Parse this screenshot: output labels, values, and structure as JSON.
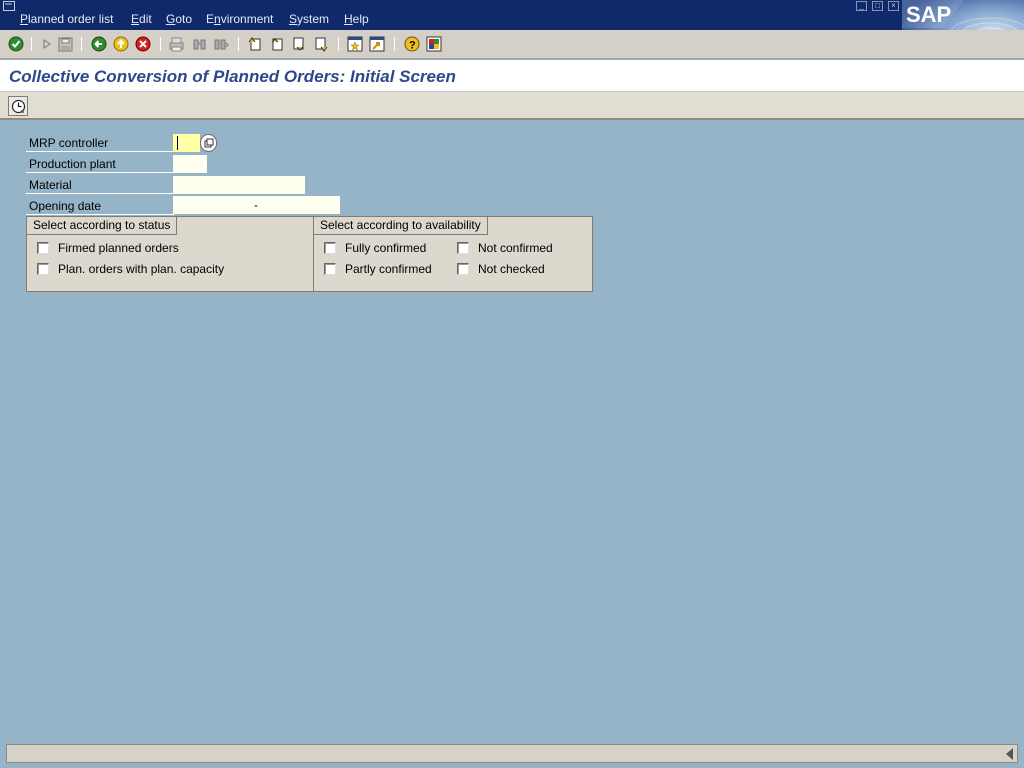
{
  "menubar": {
    "items": [
      {
        "label_ul": "P",
        "label_rest": "lanned order list"
      },
      {
        "label_ul": "E",
        "label_rest": "dit"
      },
      {
        "label_ul": "G",
        "label_rest": "oto"
      },
      {
        "label_pre": "E",
        "label_ul": "n",
        "label_rest": "vironment"
      },
      {
        "label_ul": "S",
        "label_rest": "ystem"
      },
      {
        "label_ul": "H",
        "label_rest": "elp"
      }
    ],
    "logo_text": "SAP"
  },
  "toolbar": {
    "icons": [
      "enter-icon",
      "back-arrow-icon",
      "save-icon",
      "back-icon",
      "exit-icon",
      "cancel-icon",
      "print-icon",
      "find-icon",
      "find-next-icon",
      "first-page-icon",
      "previous-page-icon",
      "next-page-icon",
      "last-page-icon",
      "create-session-icon",
      "create-shortcut-icon",
      "help-icon",
      "customize-layout-icon"
    ]
  },
  "title": "Collective Conversion of Planned Orders: Initial Screen",
  "apptoolbar": {
    "execute_icon": "execute-clock-icon"
  },
  "fields": {
    "mrp_controller": {
      "label": "MRP controller",
      "value": ""
    },
    "production_plant": {
      "label": "Production plant",
      "value": ""
    },
    "material": {
      "label": "Material",
      "value": ""
    },
    "opening_date": {
      "label": "Opening date",
      "from": "",
      "to": "",
      "separator": "-"
    }
  },
  "status_group": {
    "title": "Select according to status",
    "options": [
      {
        "label": "Firmed planned orders",
        "checked": false
      },
      {
        "label": "Plan. orders with plan. capacity",
        "checked": false
      }
    ]
  },
  "availability_group": {
    "title": "Select according to availability",
    "options": [
      {
        "label": "Fully confirmed",
        "checked": false
      },
      {
        "label": "Not confirmed",
        "checked": false
      },
      {
        "label": "Partly confirmed",
        "checked": false
      },
      {
        "label": "Not checked",
        "checked": false
      }
    ]
  },
  "colors": {
    "menubar_bg": "#10296b",
    "body_bg": "#95b4c7",
    "title_text": "#2a4a8c",
    "input_bg": "#fffff0",
    "active_input_bg": "#ffffa6"
  }
}
